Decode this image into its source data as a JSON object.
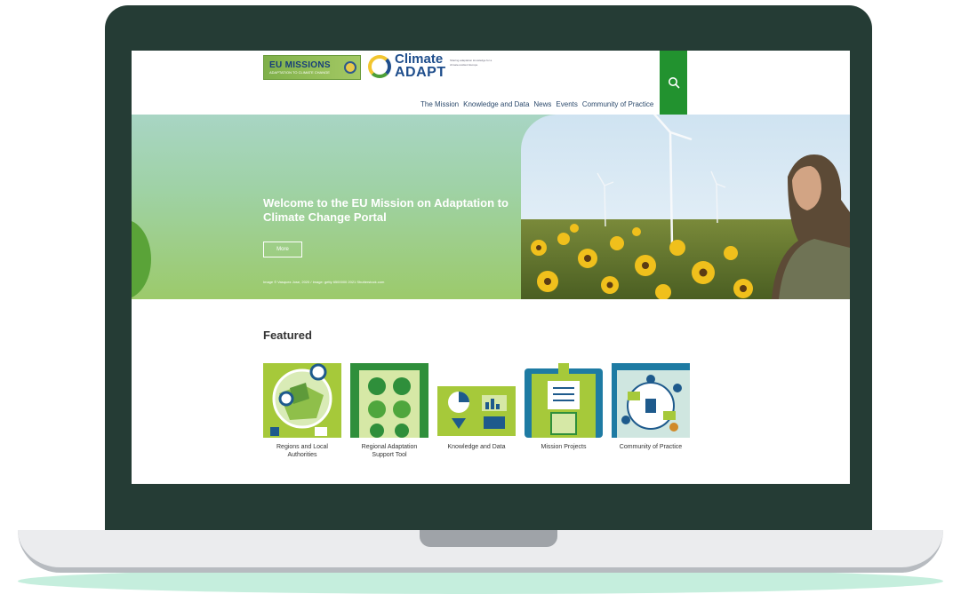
{
  "header": {
    "eu_missions_logo": "EU MISSIONS",
    "eu_missions_sub": "ADAPTATION TO CLIMATE CHANGE",
    "climate_adapt_logo_line1": "Climate",
    "climate_adapt_logo_line2": "ADAPT",
    "climate_adapt_tagline": "Sharing adaptation knowledge for a climate-resilient Europe"
  },
  "nav": {
    "items": [
      "The Mission",
      "Knowledge and Data",
      "News",
      "Events",
      "Community of Practice"
    ]
  },
  "hero": {
    "title": "Welcome to the EU Mission on Adaptation to Climate Change Portal",
    "button_label": "More",
    "credit": "Image © Vasquez Jose, 2020 / Image: getty 6500000 2021 Shutterstock.com"
  },
  "featured": {
    "heading": "Featured",
    "cards": [
      {
        "label": "Regions and Local Authorities"
      },
      {
        "label": "Regional Adaptation Support Tool"
      },
      {
        "label": "Knowledge and Data"
      },
      {
        "label": "Mission Projects"
      },
      {
        "label": "Community of Practice"
      }
    ]
  },
  "colors": {
    "frame": "#253c35",
    "accent_green": "#22922f",
    "hero_start": "#a8d5c4",
    "hero_end": "#9cca6b",
    "card_teal": "#1e7ba3"
  },
  "icons": {
    "search": "search-icon"
  }
}
